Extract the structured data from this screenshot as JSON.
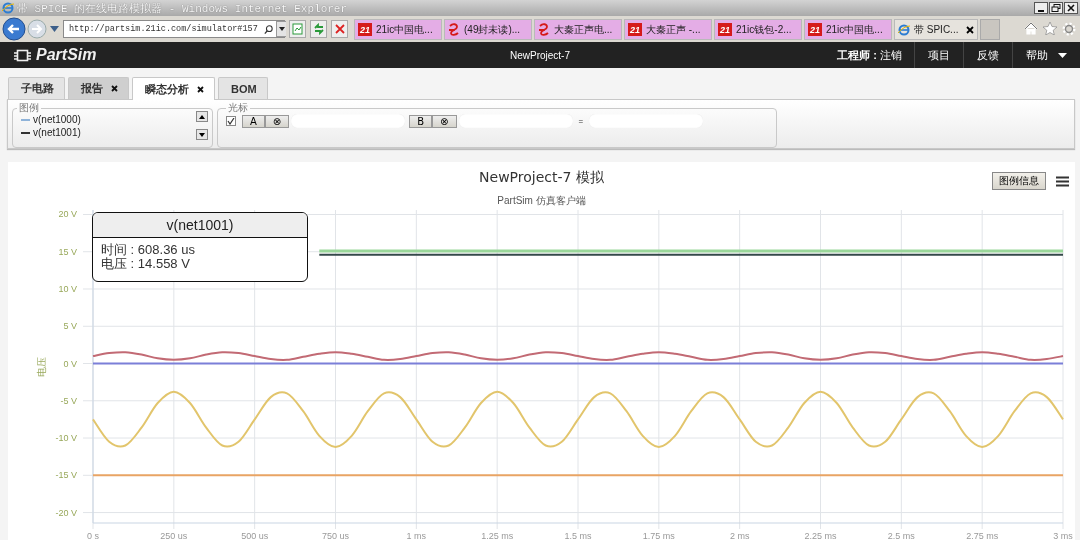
{
  "window": {
    "title": "带 SPICE 的在线电路模拟器 - Windows Internet Explorer"
  },
  "browser": {
    "address": "http://partsim.21ic.com/simulator#157",
    "tabs": [
      {
        "label": "21ic中国电...",
        "kind": "site21",
        "badge": "21",
        "selected": false
      },
      {
        "label": "(49封未读)...",
        "kind": "mail",
        "selected": false
      },
      {
        "label": "大秦正声电...",
        "kind": "mail",
        "selected": false
      },
      {
        "label": "大秦正声 -...",
        "kind": "site21",
        "badge": "21",
        "selected": false
      },
      {
        "label": "21ic钱包-2...",
        "kind": "site21",
        "badge": "21",
        "selected": false
      },
      {
        "label": "21ic中国电...",
        "kind": "site21",
        "badge": "21",
        "selected": false
      },
      {
        "label": "带 SPIC...",
        "kind": "ie",
        "selected": true
      }
    ]
  },
  "app": {
    "brand": "PartSim",
    "project": "NewProject-7",
    "user_label": "工程师 :",
    "logout": "注销",
    "menu": [
      {
        "label": "项目",
        "kind": "link"
      },
      {
        "label": "反馈",
        "kind": "link"
      },
      {
        "label": "帮助",
        "kind": "dropdown"
      }
    ]
  },
  "tabs": [
    {
      "label": "子电路",
      "closable": false,
      "selected": false
    },
    {
      "label": "报告",
      "closable": true,
      "selected": false
    },
    {
      "label": "瞬态分析",
      "closable": true,
      "selected": true
    },
    {
      "label": "BOM",
      "closable": false,
      "selected": false
    }
  ],
  "legend": {
    "title": "图例",
    "items": [
      {
        "name": "v(net1000)",
        "color": "#8fb3d9"
      },
      {
        "name": "v(net1001)",
        "color": "#333333"
      }
    ]
  },
  "cursor": {
    "title": "光标",
    "checked": true,
    "markers": [
      {
        "label": "A",
        "clear": "⊗"
      },
      {
        "label": "B",
        "clear": "⊗"
      }
    ],
    "equals": "="
  },
  "chart": {
    "legend_button": "图例信息",
    "subtitle": "PartSim 仿真客户端",
    "microsecond_tick_labels": [
      "250 us",
      "500 us",
      "750 us"
    ],
    "tooltip": {
      "title": "v(net1001)",
      "lines": [
        "时间 : 608.36 us",
        "电压 : 14.558 V"
      ]
    },
    "chart_data": {
      "type": "line",
      "title": "NewProject-7 模拟",
      "ylabel": "电压",
      "grid": true,
      "x": [
        0,
        0.05,
        0.1,
        0.15,
        0.2,
        0.25,
        0.3,
        0.35,
        0.4,
        0.45,
        0.5,
        0.55,
        0.6,
        0.65,
        0.7,
        0.75,
        0.8,
        0.85,
        0.9,
        0.95,
        1,
        1.05,
        1.1,
        1.15,
        1.2,
        1.25,
        1.3,
        1.35,
        1.4,
        1.45,
        1.5,
        1.55,
        1.6,
        1.65,
        1.7,
        1.75,
        1.8,
        1.85,
        1.9,
        1.95,
        2,
        2.05,
        2.1,
        2.15,
        2.2,
        2.25,
        2.3,
        2.35,
        2.4,
        2.45,
        2.5,
        2.55,
        2.6,
        2.65,
        2.7,
        2.75,
        2.8,
        2.85,
        2.9,
        2.95,
        3
      ],
      "series": [
        {
          "color": "#9ad79a",
          "values": [
            null,
            null,
            null,
            null,
            null,
            null,
            null,
            null,
            null,
            null,
            null,
            null,
            null,
            null,
            15.1,
            15.1,
            15.1,
            15.1,
            15.1,
            15.1,
            15.1,
            15.1,
            15.1,
            15.1,
            15.1,
            15.1,
            15.1,
            15.1,
            15.1,
            15.1,
            15.1,
            15.1,
            15.1,
            15.1,
            15.1,
            15.1,
            15.1,
            15.1,
            15.1,
            15.1,
            15.1,
            15.1,
            15.1,
            15.1,
            15.1,
            15.1,
            15.1,
            15.1,
            15.1,
            15.1,
            15.1,
            15.1,
            15.1,
            15.1,
            15.1,
            15.1,
            15.1,
            15.1,
            15.1,
            15.1,
            15.1
          ]
        },
        {
          "color": "#34494a",
          "values": [
            null,
            null,
            null,
            null,
            null,
            null,
            null,
            null,
            null,
            null,
            null,
            null,
            null,
            null,
            14.6,
            14.6,
            14.6,
            14.6,
            14.6,
            14.6,
            14.6,
            14.6,
            14.6,
            14.6,
            14.6,
            14.6,
            14.6,
            14.6,
            14.6,
            14.6,
            14.6,
            14.6,
            14.6,
            14.6,
            14.6,
            14.6,
            14.6,
            14.6,
            14.6,
            14.6,
            14.6,
            14.6,
            14.6,
            14.6,
            14.6,
            14.6,
            14.6,
            14.6,
            14.6,
            14.6,
            14.6,
            14.6,
            14.6,
            14.6,
            14.6,
            14.6,
            14.6,
            14.6,
            14.6,
            14.6,
            14.6
          ]
        },
        {
          "color": "#c26a74",
          "values": [
            1,
            1.4,
            1.5,
            1.2,
            0.7,
            0.5,
            0.7,
            1.2,
            1.5,
            1.4,
            1,
            0.6,
            0.5,
            0.9,
            1.3,
            1.5,
            1.3,
            0.9,
            0.5,
            0.6,
            1,
            1.4,
            1.5,
            1.2,
            0.7,
            0.5,
            0.7,
            1.2,
            1.5,
            1.4,
            1,
            0.6,
            0.5,
            0.9,
            1.3,
            1.5,
            1.3,
            0.9,
            0.5,
            0.6,
            1,
            1.4,
            1.5,
            1.2,
            0.7,
            0.5,
            0.7,
            1.2,
            1.5,
            1.4,
            1,
            0.6,
            0.5,
            0.9,
            1.3,
            1.5,
            1.3,
            0.9,
            0.5,
            0.6,
            1
          ]
        },
        {
          "color": "#7b7fd8",
          "values": [
            0,
            0,
            0,
            0,
            0,
            0,
            0,
            0,
            0,
            0,
            0,
            0,
            0,
            0,
            0,
            0,
            0,
            0,
            0,
            0,
            0,
            0,
            0,
            0,
            0,
            0,
            0,
            0,
            0,
            0,
            0,
            0,
            0,
            0,
            0,
            0,
            0,
            0,
            0,
            0,
            0,
            0,
            0,
            0,
            0,
            0,
            0,
            0,
            0,
            0,
            0,
            0,
            0,
            0,
            0,
            0,
            0,
            0,
            0,
            0,
            0
          ]
        },
        {
          "color": "#e2c56c",
          "values": [
            -7.5,
            -10.5,
            -11,
            -8.6,
            -5.3,
            -3.8,
            -5.3,
            -8.6,
            -11,
            -10.5,
            -7.5,
            -4.5,
            -4,
            -6.4,
            -9.7,
            -11.2,
            -9.7,
            -6.4,
            -4,
            -4.5,
            -7.5,
            -10.5,
            -11,
            -8.6,
            -5.3,
            -3.8,
            -5.3,
            -8.6,
            -11,
            -10.5,
            -7.5,
            -4.5,
            -4,
            -6.4,
            -9.7,
            -11.2,
            -9.7,
            -6.4,
            -4,
            -4.5,
            -7.5,
            -10.5,
            -11,
            -8.6,
            -5.3,
            -3.8,
            -5.3,
            -8.6,
            -11,
            -10.5,
            -7.5,
            -4.5,
            -4,
            -6.4,
            -9.7,
            -11.2,
            -9.7,
            -6.4,
            -4,
            -4.5,
            -7.5
          ]
        },
        {
          "color": "#e9a464",
          "values": [
            -15,
            -15,
            -15,
            -15,
            -15,
            -15,
            -15,
            -15,
            -15,
            -15,
            -15,
            -15,
            -15,
            -15,
            -15,
            -15,
            -15,
            -15,
            -15,
            -15,
            -15,
            -15,
            -15,
            -15,
            -15,
            -15,
            -15,
            -15,
            -15,
            -15,
            -15,
            -15,
            -15,
            -15,
            -15,
            -15,
            -15,
            -15,
            -15,
            -15,
            -15,
            -15,
            -15,
            -15,
            -15,
            -15,
            -15,
            -15,
            -15,
            -15,
            -15,
            -15,
            -15,
            -15,
            -15,
            -15,
            -15,
            -15,
            -15,
            -15,
            -15
          ]
        }
      ],
      "xlim": [
        0,
        3
      ],
      "ylim": [
        -21.4,
        20.6
      ],
      "xticks": [
        {
          "value": 0,
          "label": "0 s"
        },
        {
          "value": 1,
          "label": "1 ms"
        },
        {
          "value": 1.25,
          "label": "1.25 ms"
        },
        {
          "value": 1.5,
          "label": "1.5 ms"
        },
        {
          "value": 1.75,
          "label": "1.75 ms"
        },
        {
          "value": 2,
          "label": "2 ms"
        },
        {
          "value": 2.25,
          "label": "2.25 ms"
        },
        {
          "value": 2.5,
          "label": "2.5 ms"
        },
        {
          "value": 2.75,
          "label": "2.75 ms"
        },
        {
          "value": 3,
          "label": "3 ms"
        }
      ],
      "yticks": [
        {
          "value": 20,
          "label": "20 V"
        },
        {
          "value": 15,
          "label": "15 V"
        },
        {
          "value": 10,
          "label": "10 V"
        },
        {
          "value": 5,
          "label": "5 V"
        },
        {
          "value": 0,
          "label": "0 V"
        },
        {
          "value": -5,
          "label": "-5 V"
        },
        {
          "value": -10,
          "label": "-10 V"
        },
        {
          "value": -15,
          "label": "-15 V"
        },
        {
          "value": -20,
          "label": "-20 V"
        }
      ]
    }
  }
}
